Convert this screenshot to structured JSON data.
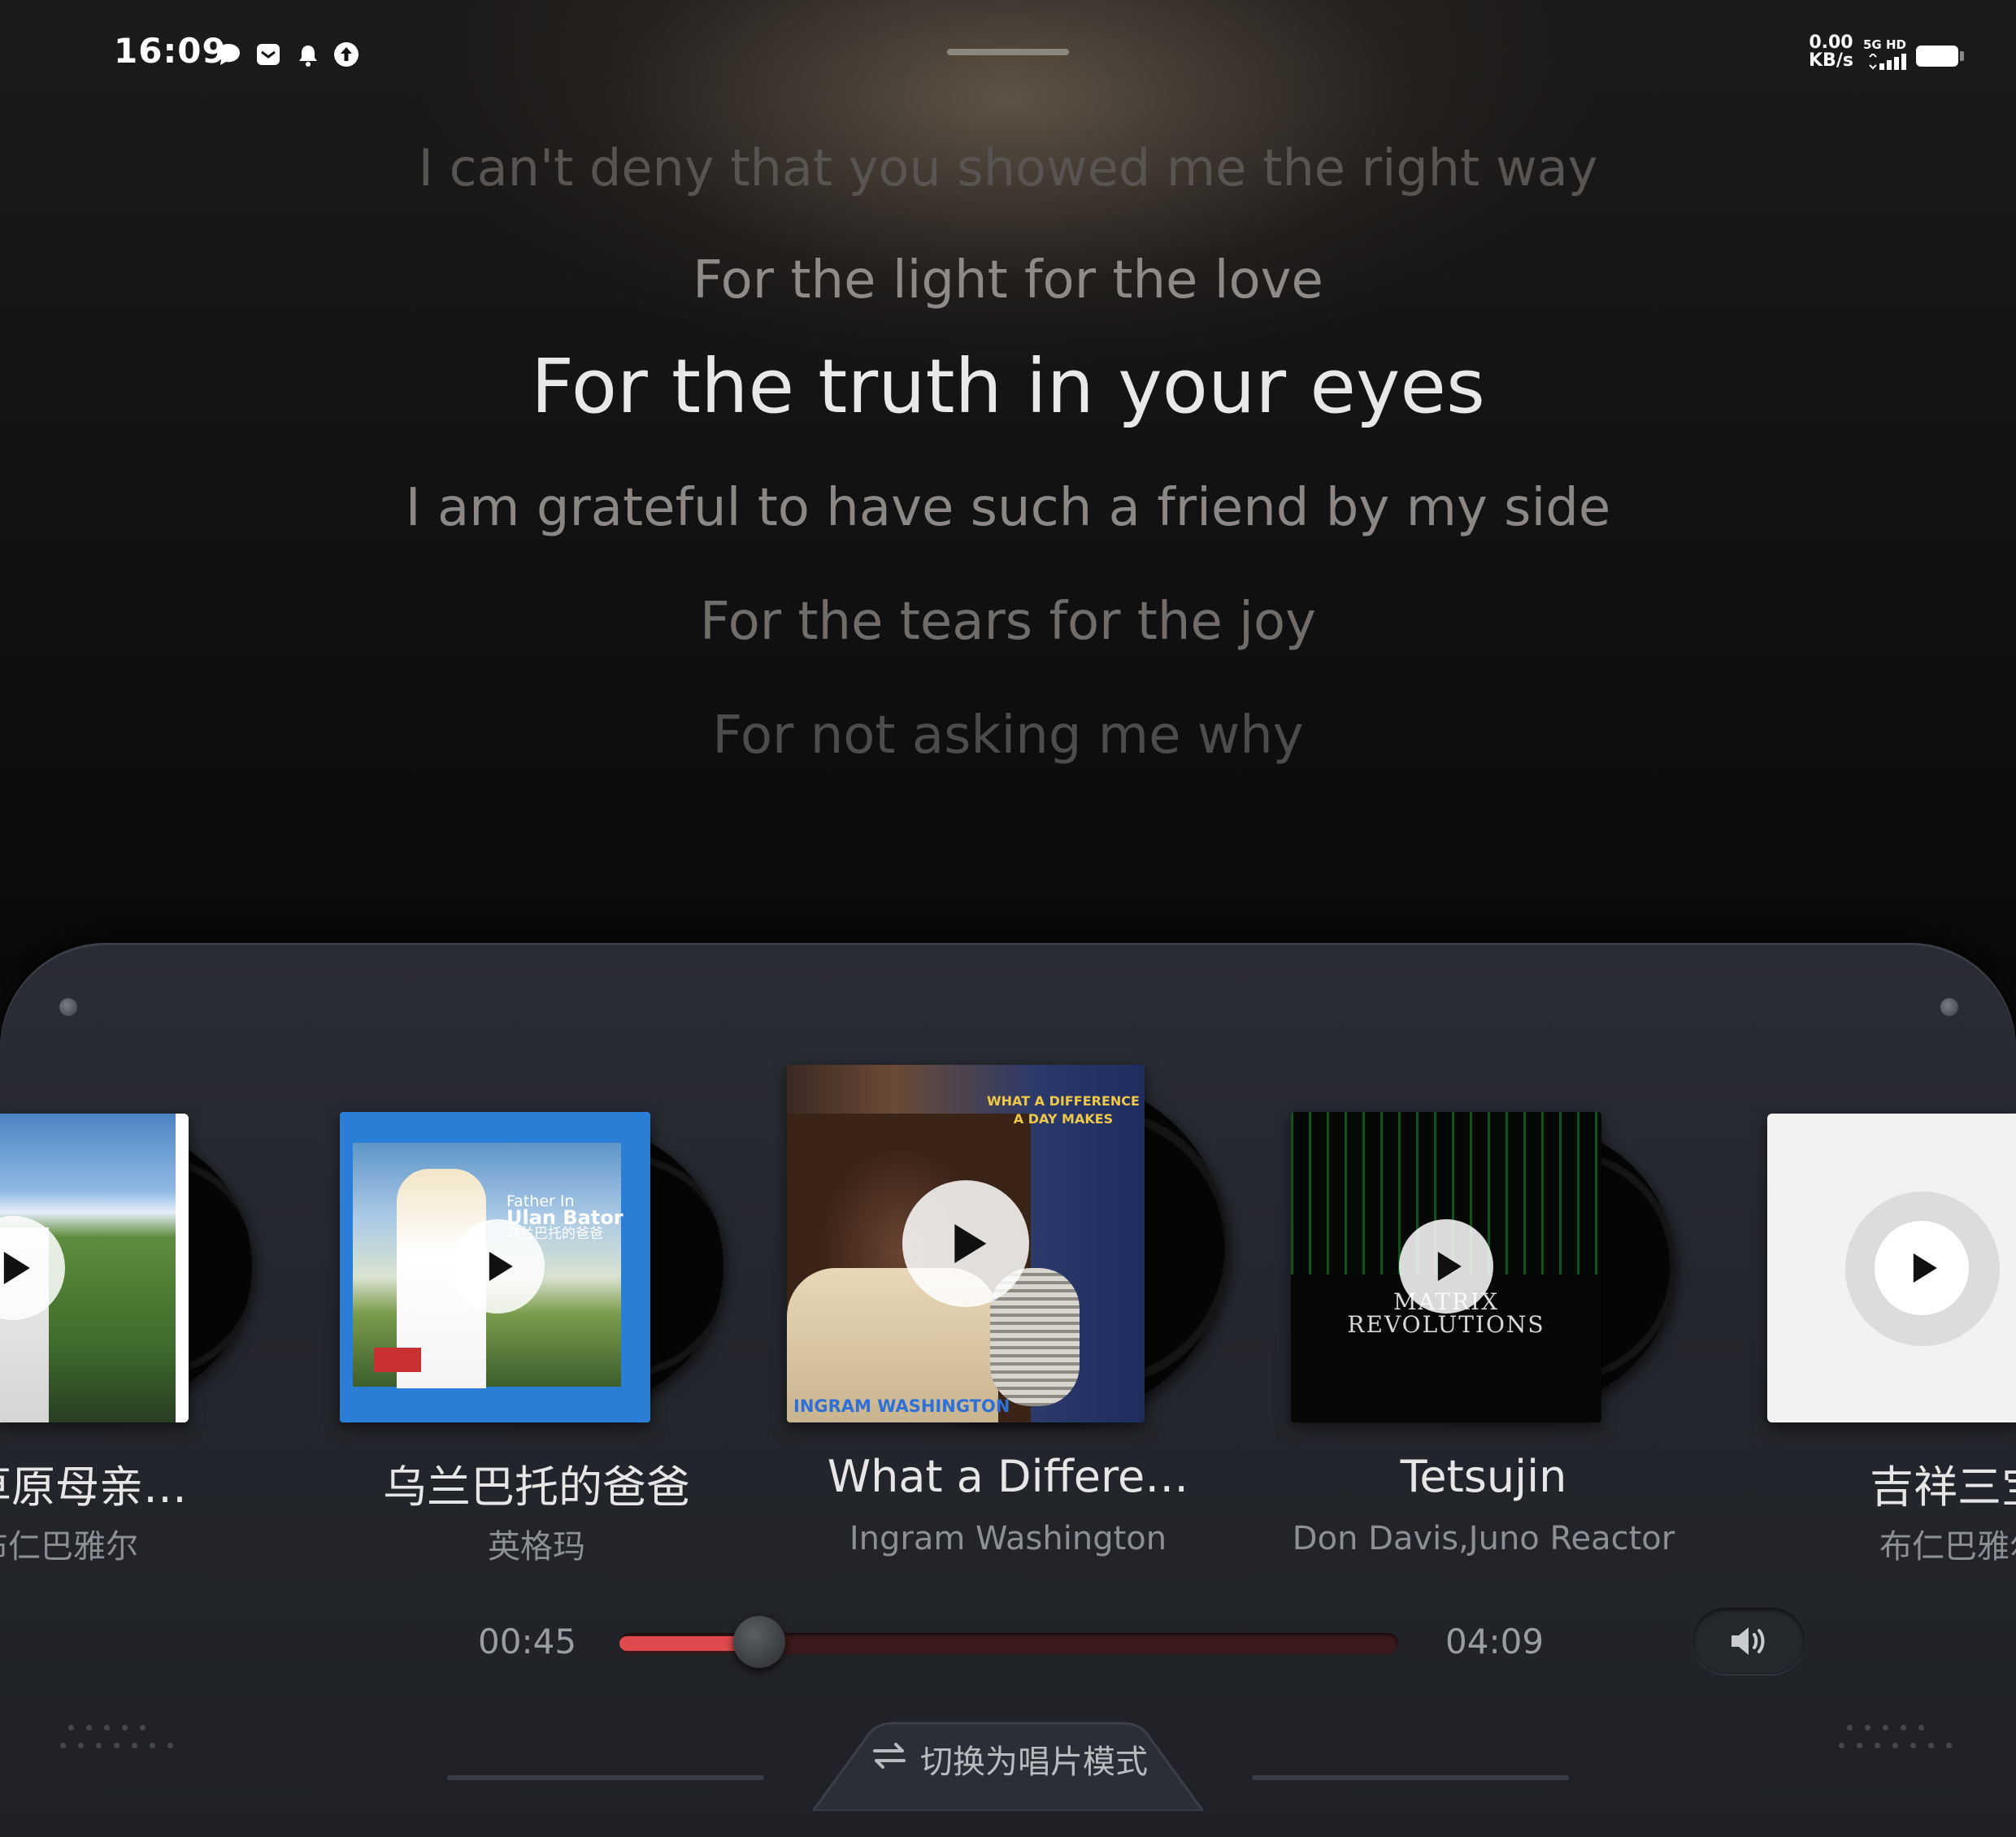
{
  "status_bar": {
    "time": "16:09",
    "icons": [
      "message-icon",
      "mail-icon",
      "bell-icon",
      "upload-icon"
    ],
    "net_speed_value": "0.00",
    "net_speed_unit": "KB/s",
    "network": "5G HD"
  },
  "lyrics": [
    "I can't deny that you showed me the right way",
    "For the light for the love",
    "For the truth in your eyes",
    "I am grateful to have such a friend by my side",
    "For the tears for the joy",
    "For not asking me why"
  ],
  "current_lyric_index": 2,
  "albums": [
    {
      "title": "草原母亲…",
      "artist": "布仁巴雅尔"
    },
    {
      "title": "乌兰巴托的爸爸",
      "artist": "英格玛",
      "cover_text_1": "Father In",
      "cover_text_2": "Ulan Bator",
      "cover_text_3": "乌兰巴托的爸爸"
    },
    {
      "title": "What a Differe…",
      "artist": "Ingram Washington",
      "cover_text_1": "WHAT A DIFFERENCE",
      "cover_text_2": "A DAY MAKES",
      "cover_text_3": "INGRAM WASHINGTON"
    },
    {
      "title": "Tetsujin",
      "artist": "Don Davis,Juno Reactor",
      "cover_text_1": "MATRIX",
      "cover_text_2": "REVOLUTIONS"
    },
    {
      "title": "吉祥三宝",
      "artist": "布仁巴雅尔"
    }
  ],
  "player": {
    "elapsed": "00:45",
    "duration": "04:09",
    "progress": 0.18,
    "accent_color": "#e04a4c"
  },
  "switch_mode_label": "切换为唱片模式"
}
